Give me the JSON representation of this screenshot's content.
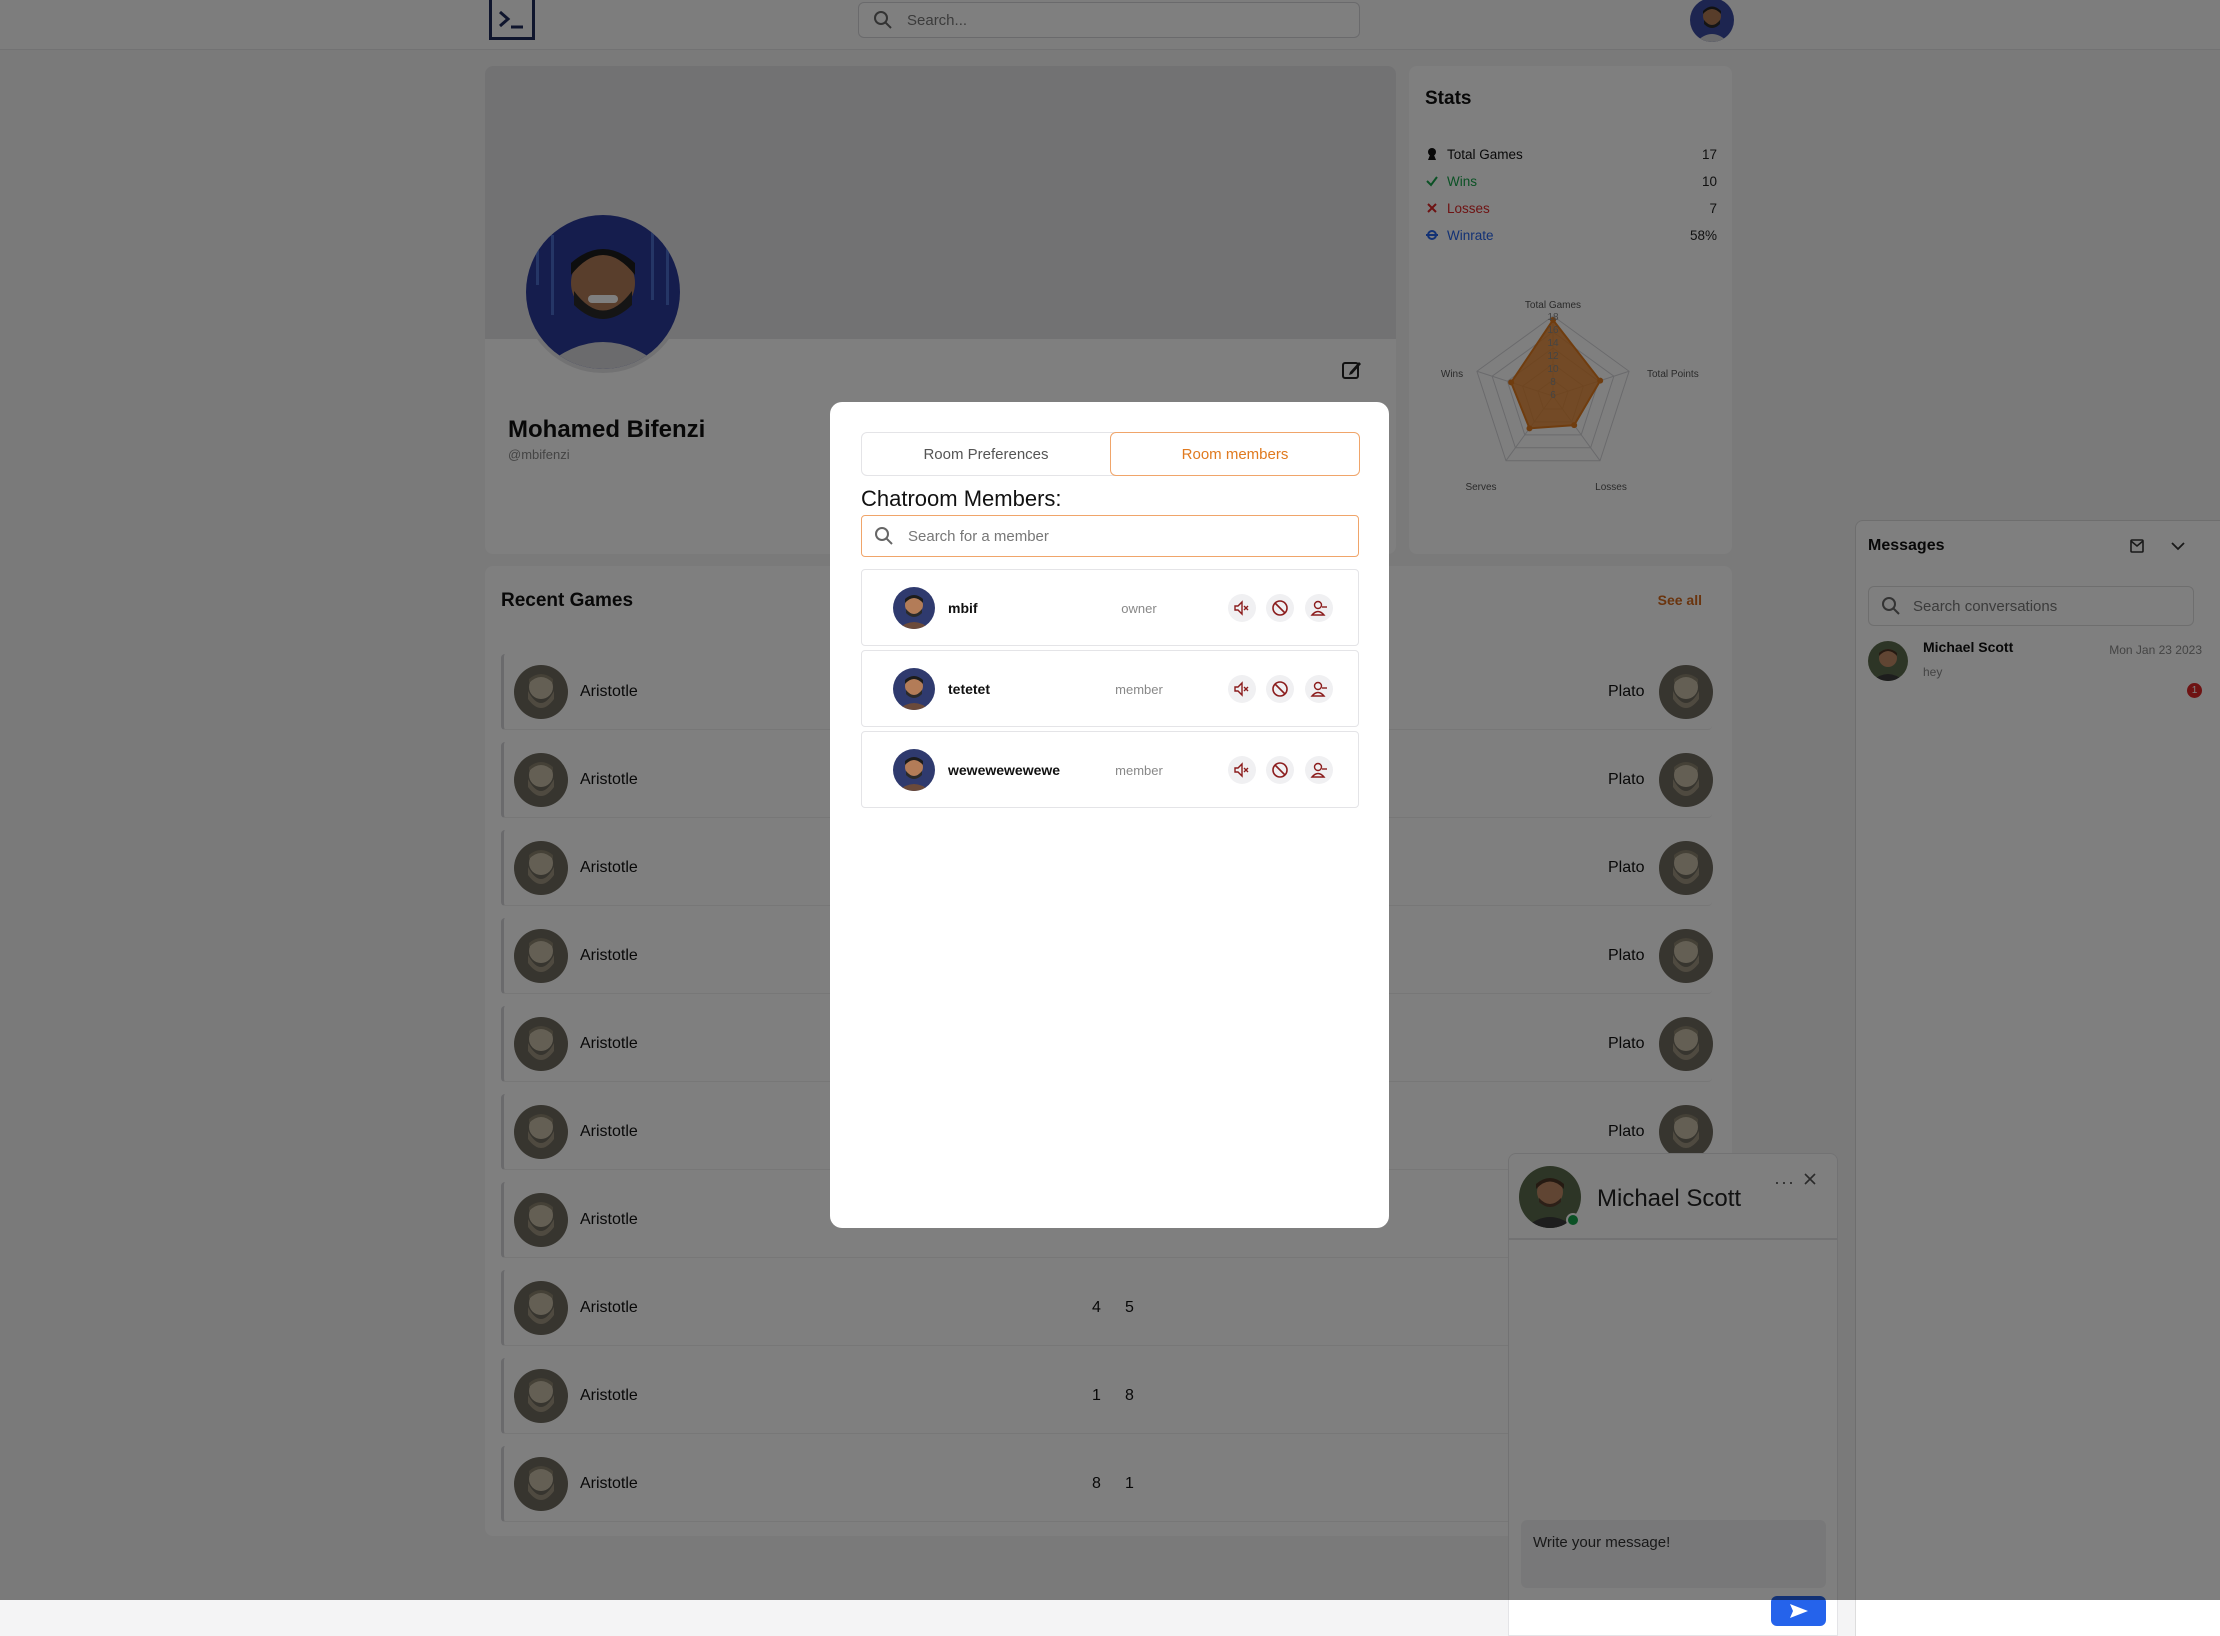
{
  "topbar": {
    "search_placeholder": "Search..."
  },
  "profile": {
    "name": "Mohamed Bifenzi",
    "handle": "@mbifenzi"
  },
  "stats": {
    "title": "Stats",
    "rows": [
      {
        "label": "Total Games",
        "value": "17",
        "color": "#111111",
        "icon": "pawn-icon"
      },
      {
        "label": "Wins",
        "value": "10",
        "color": "#16a34a",
        "icon": "check-icon"
      },
      {
        "label": "Losses",
        "value": "7",
        "color": "#dc2626",
        "icon": "x-icon"
      },
      {
        "label": "Winrate",
        "value": "58%",
        "color": "#2563eb",
        "icon": "target-icon"
      }
    ],
    "radar": {
      "axes": [
        "Total Games",
        "Total Points",
        "Losses",
        "Serves",
        "Wins"
      ],
      "ticks": [
        "18",
        "16",
        "14",
        "12",
        "10",
        "8",
        "6"
      ],
      "fill_color": "#e07a1f"
    }
  },
  "recent_games": {
    "title": "Recent Games",
    "see_all": "See all",
    "rows": [
      {
        "player1": "Aristotle",
        "score1": "",
        "score2": "",
        "player2": "Plato"
      },
      {
        "player1": "Aristotle",
        "score1": "",
        "score2": "",
        "player2": "Plato"
      },
      {
        "player1": "Aristotle",
        "score1": "",
        "score2": "",
        "player2": "Plato"
      },
      {
        "player1": "Aristotle",
        "score1": "",
        "score2": "",
        "player2": "Plato"
      },
      {
        "player1": "Aristotle",
        "score1": "",
        "score2": "",
        "player2": "Plato"
      },
      {
        "player1": "Aristotle",
        "score1": "",
        "score2": "",
        "player2": "Plato"
      },
      {
        "player1": "Aristotle",
        "score1": "",
        "score2": "",
        "player2": ""
      },
      {
        "player1": "Aristotle",
        "score1": "4",
        "score2": "5",
        "player2": ""
      },
      {
        "player1": "Aristotle",
        "score1": "1",
        "score2": "8",
        "player2": ""
      },
      {
        "player1": "Aristotle",
        "score1": "8",
        "score2": "1",
        "player2": ""
      }
    ]
  },
  "messages": {
    "title": "Messages",
    "search_placeholder": "Search conversations",
    "conversations": [
      {
        "name": "Michael Scott",
        "preview": "hey",
        "date": "Mon Jan 23 2023",
        "unread": "1"
      }
    ]
  },
  "chat": {
    "name": "Michael Scott",
    "more": "···",
    "input_placeholder": "Write your message!"
  },
  "modal": {
    "tabs": [
      {
        "label": "Room Preferences",
        "active": false
      },
      {
        "label": "Room members",
        "active": true
      }
    ],
    "heading": "Chatroom Members:",
    "search_placeholder": "Search for a member",
    "members": [
      {
        "name": "mbif",
        "role": "owner"
      },
      {
        "name": "tetetet",
        "role": "member"
      },
      {
        "name": "wewewewewewe",
        "role": "member"
      }
    ]
  }
}
